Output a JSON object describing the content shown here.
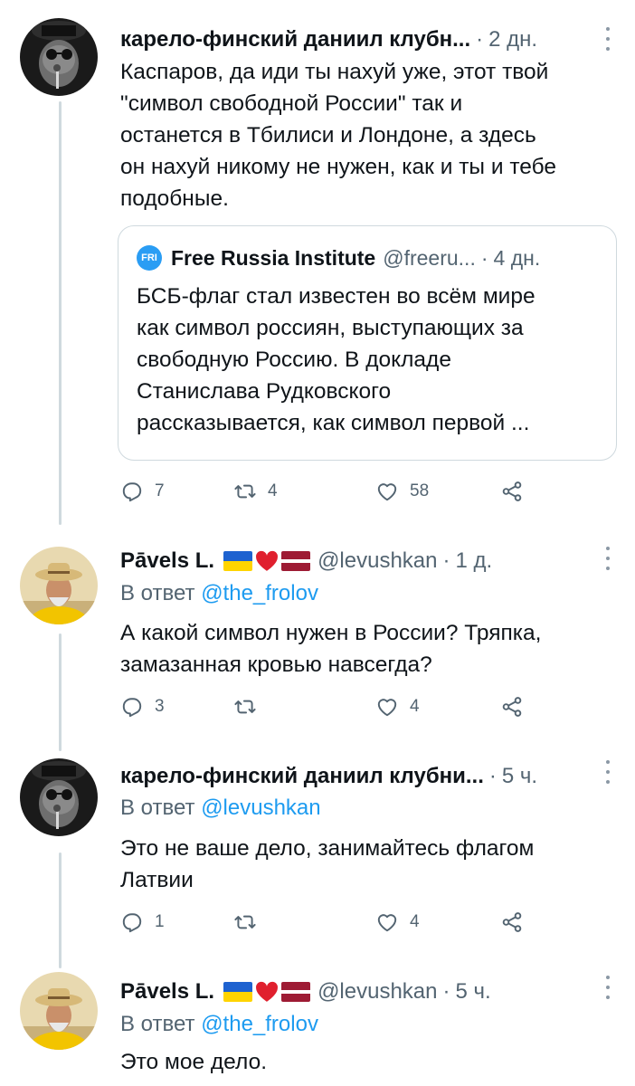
{
  "tweets": [
    {
      "name": "карело-финский даниил клубн...",
      "time": "2 дн.",
      "text": "Каспаров, да иди ты нахуй уже, этот твой\n\"символ свободной России\" так и\nостанется в Тбилиси и Лондоне, а здесь\nон нахуй никому не нужен, как и ты и тебе\nподобные.",
      "quote": {
        "logo": "FRI",
        "name": "Free Russia Institute",
        "handle": "@freeru...",
        "time": "4 дн.",
        "text": "БСБ-флаг стал известен во всём мире\nкак символ россиян, выступающих за\nсвободную Россию. В докладе\nСтанислава Рудковского\nрассказывается, как символ первой ..."
      },
      "replies": "7",
      "retweets": "4",
      "likes": "58"
    },
    {
      "name": "Pāvels L.",
      "handle": "@levushkan",
      "time": "1 д.",
      "reply_prefix": "В ответ",
      "reply_to": "@the_frolov",
      "text": "А какой символ нужен в России? Тряпка,\nзамазанная кровью навсегда?",
      "replies": "3",
      "retweets": "",
      "likes": "4"
    },
    {
      "name": "карело-финский даниил клубни...",
      "time": "5 ч.",
      "reply_prefix": "В ответ",
      "reply_to": "@levushkan",
      "text": "Это не ваше дело, занимайтесь флагом\nЛатвии",
      "replies": "1",
      "retweets": "",
      "likes": "4"
    },
    {
      "name": "Pāvels L.",
      "handle": "@levushkan",
      "time": "5 ч.",
      "reply_prefix": "В ответ",
      "reply_to": "@the_frolov",
      "text": "Это мое дело."
    }
  ],
  "flag_emojis": [
    "ukraine-flag",
    "red-heart",
    "latvia-flag"
  ],
  "icons": [
    "reply-icon",
    "retweet-icon",
    "like-icon",
    "share-icon",
    "more-icon"
  ],
  "colors": {
    "text": "#0f1419",
    "secondary": "#536471",
    "link": "#1d9bf0",
    "border": "#cfd9de"
  }
}
